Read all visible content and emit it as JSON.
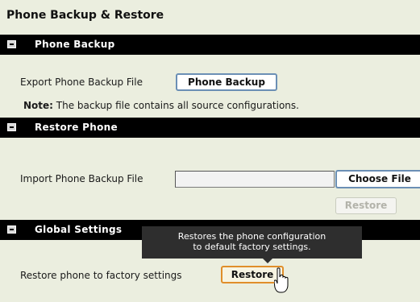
{
  "page_title": "Phone Backup & Restore",
  "sections": {
    "backup": {
      "title": "Phone Backup",
      "export_label": "Export Phone Backup File",
      "export_button": "Phone Backup",
      "note_label": "Note:",
      "note_text": "The backup file contains all source configurations."
    },
    "restore": {
      "title": "Restore Phone",
      "import_label": "Import Phone Backup File",
      "file_value": "",
      "choose_file_button": "Choose File",
      "restore_button": "Restore"
    },
    "global": {
      "title": "Global Settings",
      "factory_label": "Restore phone to factory settings",
      "factory_button": "Restore",
      "tooltip_line1": "Restores the phone configuration",
      "tooltip_line2": "to default factory settings."
    }
  }
}
